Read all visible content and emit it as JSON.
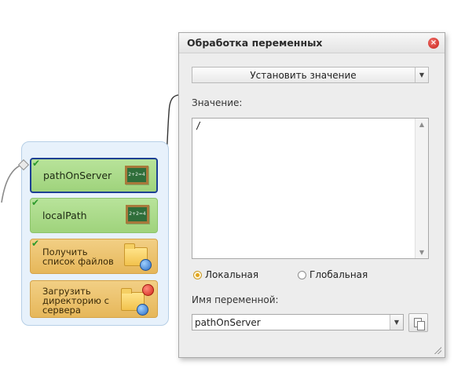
{
  "blocks": [
    {
      "label": "pathOnServer",
      "icon": "chalkboard-icon",
      "checked": true,
      "selected": true
    },
    {
      "label": "localPath",
      "icon": "chalkboard-icon",
      "checked": true,
      "selected": false
    },
    {
      "label": "Получить список файлов",
      "icon": "folder-web-icon",
      "checked": true,
      "selected": false
    },
    {
      "label": "Загрузить директорию с сервера",
      "icon": "folder-web-icon",
      "checked": false,
      "stop": true,
      "selected": false
    }
  ],
  "board_text": "2+2=4",
  "dialog": {
    "title": "Обработка переменных",
    "action": "Установить значение",
    "value_label": "Значение:",
    "value_text": "/",
    "scope_local": "Локальная",
    "scope_global": "Глобальная",
    "scope_selected": "local",
    "name_label": "Имя переменной:",
    "name_value": "pathOnServer"
  },
  "colors": {
    "block_green": "#9fd37c",
    "block_orange": "#e6b75a",
    "selection": "#1c3f93"
  }
}
